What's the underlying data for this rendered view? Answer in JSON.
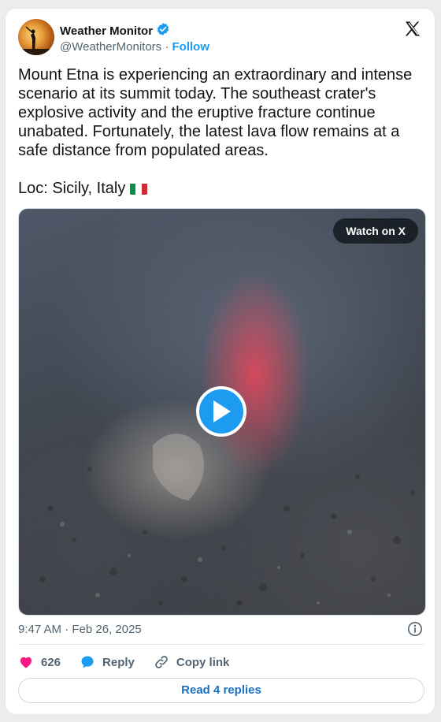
{
  "author": {
    "name": "Weather Monitor",
    "handle": "@WeatherMonitors",
    "separator": "·",
    "follow_label": "Follow",
    "verified": true
  },
  "tweet": {
    "text": "Mount Etna is experiencing an extraordinary and intense scenario at its summit today. The southeast crater's explosive activity and the eruptive fracture continue unabated. Fortunately, the latest lava flow remains at a safe distance from populated areas.",
    "location_line": "Loc: Sicily, Italy",
    "flag_icon": "italy-flag-icon"
  },
  "media": {
    "watch_label": "Watch on X",
    "play_icon": "play-icon"
  },
  "meta": {
    "timestamp": "9:47 AM · Feb 26, 2025"
  },
  "actions": {
    "like_count": "626",
    "reply_label": "Reply",
    "copy_link_label": "Copy link"
  },
  "read_replies_label": "Read 4 replies",
  "colors": {
    "accent": "#1d9bf0",
    "like": "#f91880",
    "text_secondary": "#536471"
  }
}
